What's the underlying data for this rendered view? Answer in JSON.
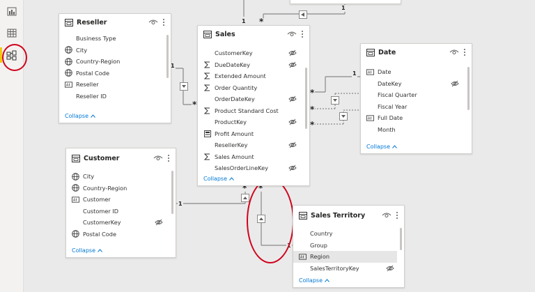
{
  "tables": {
    "reseller": {
      "title": "Reseller",
      "fields": [
        {
          "name": "Business Type",
          "icon": "none",
          "hidden": false
        },
        {
          "name": "City",
          "icon": "globe",
          "hidden": false
        },
        {
          "name": "Country-Region",
          "icon": "globe",
          "hidden": false
        },
        {
          "name": "Postal Code",
          "icon": "globe",
          "hidden": false
        },
        {
          "name": "Reseller",
          "icon": "text-field",
          "hidden": false
        },
        {
          "name": "Reseller ID",
          "icon": "none",
          "hidden": false
        }
      ],
      "collapse_label": "Collapse"
    },
    "sales": {
      "title": "Sales",
      "fields": [
        {
          "name": "CustomerKey",
          "icon": "none",
          "hidden": true
        },
        {
          "name": "DueDateKey",
          "icon": "sigma",
          "hidden": true
        },
        {
          "name": "Extended Amount",
          "icon": "sigma",
          "hidden": false
        },
        {
          "name": "Order Quantity",
          "icon": "sigma",
          "hidden": false
        },
        {
          "name": "OrderDateKey",
          "icon": "none",
          "hidden": true
        },
        {
          "name": "Product Standard Cost",
          "icon": "sigma",
          "hidden": false
        },
        {
          "name": "ProductKey",
          "icon": "none",
          "hidden": true
        },
        {
          "name": "Profit Amount",
          "icon": "calculator",
          "hidden": false
        },
        {
          "name": "ResellerKey",
          "icon": "none",
          "hidden": true
        },
        {
          "name": "Sales Amount",
          "icon": "sigma",
          "hidden": false
        },
        {
          "name": "SalesOrderLineKey",
          "icon": "none",
          "hidden": true
        }
      ],
      "collapse_label": "Collapse"
    },
    "date": {
      "title": "Date",
      "fields": [
        {
          "name": "Date",
          "icon": "text-field",
          "hidden": false
        },
        {
          "name": "DateKey",
          "icon": "none",
          "hidden": true
        },
        {
          "name": "Fiscal Quarter",
          "icon": "none",
          "hidden": false
        },
        {
          "name": "Fiscal Year",
          "icon": "none",
          "hidden": false
        },
        {
          "name": "Full Date",
          "icon": "text-field",
          "hidden": false
        },
        {
          "name": "Month",
          "icon": "none",
          "hidden": false
        }
      ],
      "collapse_label": "Collapse"
    },
    "customer": {
      "title": "Customer",
      "fields": [
        {
          "name": "City",
          "icon": "globe",
          "hidden": false
        },
        {
          "name": "Country-Region",
          "icon": "globe",
          "hidden": false
        },
        {
          "name": "Customer",
          "icon": "text-field",
          "hidden": false
        },
        {
          "name": "Customer ID",
          "icon": "none",
          "hidden": false
        },
        {
          "name": "CustomerKey",
          "icon": "none",
          "hidden": true
        },
        {
          "name": "Postal Code",
          "icon": "globe",
          "hidden": false
        }
      ],
      "collapse_label": "Collapse"
    },
    "sales_territory": {
      "title": "Sales Territory",
      "fields": [
        {
          "name": "Country",
          "icon": "none",
          "hidden": false
        },
        {
          "name": "Group",
          "icon": "none",
          "hidden": false
        },
        {
          "name": "Region",
          "icon": "text-field",
          "hidden": false,
          "selected": true
        },
        {
          "name": "SalesTerritoryKey",
          "icon": "none",
          "hidden": true
        }
      ],
      "collapse_label": "Collapse"
    }
  },
  "relationships": {
    "one": "1",
    "many": "*"
  },
  "colors": {
    "accent": "#f2c811",
    "annotation": "#d0021b",
    "link": "#0078d4"
  },
  "nav": [
    "report-view",
    "data-view",
    "model-view"
  ]
}
